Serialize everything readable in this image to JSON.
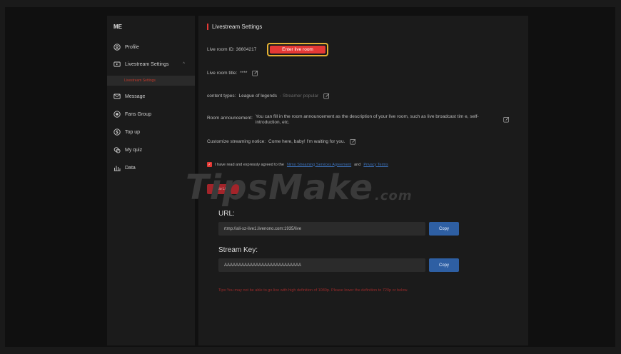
{
  "sidebar": {
    "brand": "ME",
    "items": [
      {
        "label": "Profile",
        "icon": "user-circle-icon"
      },
      {
        "label": "Livestream Settings",
        "icon": "screen-icon",
        "chevron": "^"
      },
      {
        "label": "Message",
        "icon": "envelope-icon"
      },
      {
        "label": "Fans Group",
        "icon": "target-icon"
      },
      {
        "label": "Top up",
        "icon": "coin-icon"
      },
      {
        "label": "My quiz",
        "icon": "quiz-icon"
      },
      {
        "label": "Data",
        "icon": "chart-icon"
      }
    ],
    "sub_item": "Livestream Settings"
  },
  "main": {
    "title": "Livestream Settings",
    "room_id_label": "Live room ID: 36604217",
    "enter_button": "Enter live room",
    "room_title_label": "Live room title:",
    "room_title_value": "****",
    "content_types_label": "content types:",
    "content_types_value": "League of legends",
    "content_types_sub": "- Streamer popular",
    "announcement_label": "Room announcement:",
    "announcement_text": "You can fill in the room announcement as the description of your live room, such as live broadcast tim e, self-introduction, etc.",
    "notice_label": "Customize streaming notice:",
    "notice_value": "Come here, baby! I'm waiting for you.",
    "agree_text": "I have read and expressly agreed to the",
    "agree_link1": "Nimo Streaming Services Agreement",
    "agree_and": "and",
    "agree_link2": "Privacy Terms",
    "go_live": "Go Live",
    "url_label": "URL:",
    "url_value": "rtmp://ali-sz-live1.livenono.com:1935/live",
    "copy_label": "Copy",
    "key_label": "Stream Key:",
    "key_value": "AAAAAAAAAAAAAAAAAAAAAAAAAAA",
    "tips": "Tips:You may not be able to go live with high definition of 1080p. Please lower the definition to 720p or below."
  },
  "watermark": {
    "text": "TipsMake",
    "tld": ".com"
  },
  "colors": {
    "accent": "#e53935",
    "highlight_border": "#e6b333",
    "copy_button": "#2e5fa3"
  }
}
